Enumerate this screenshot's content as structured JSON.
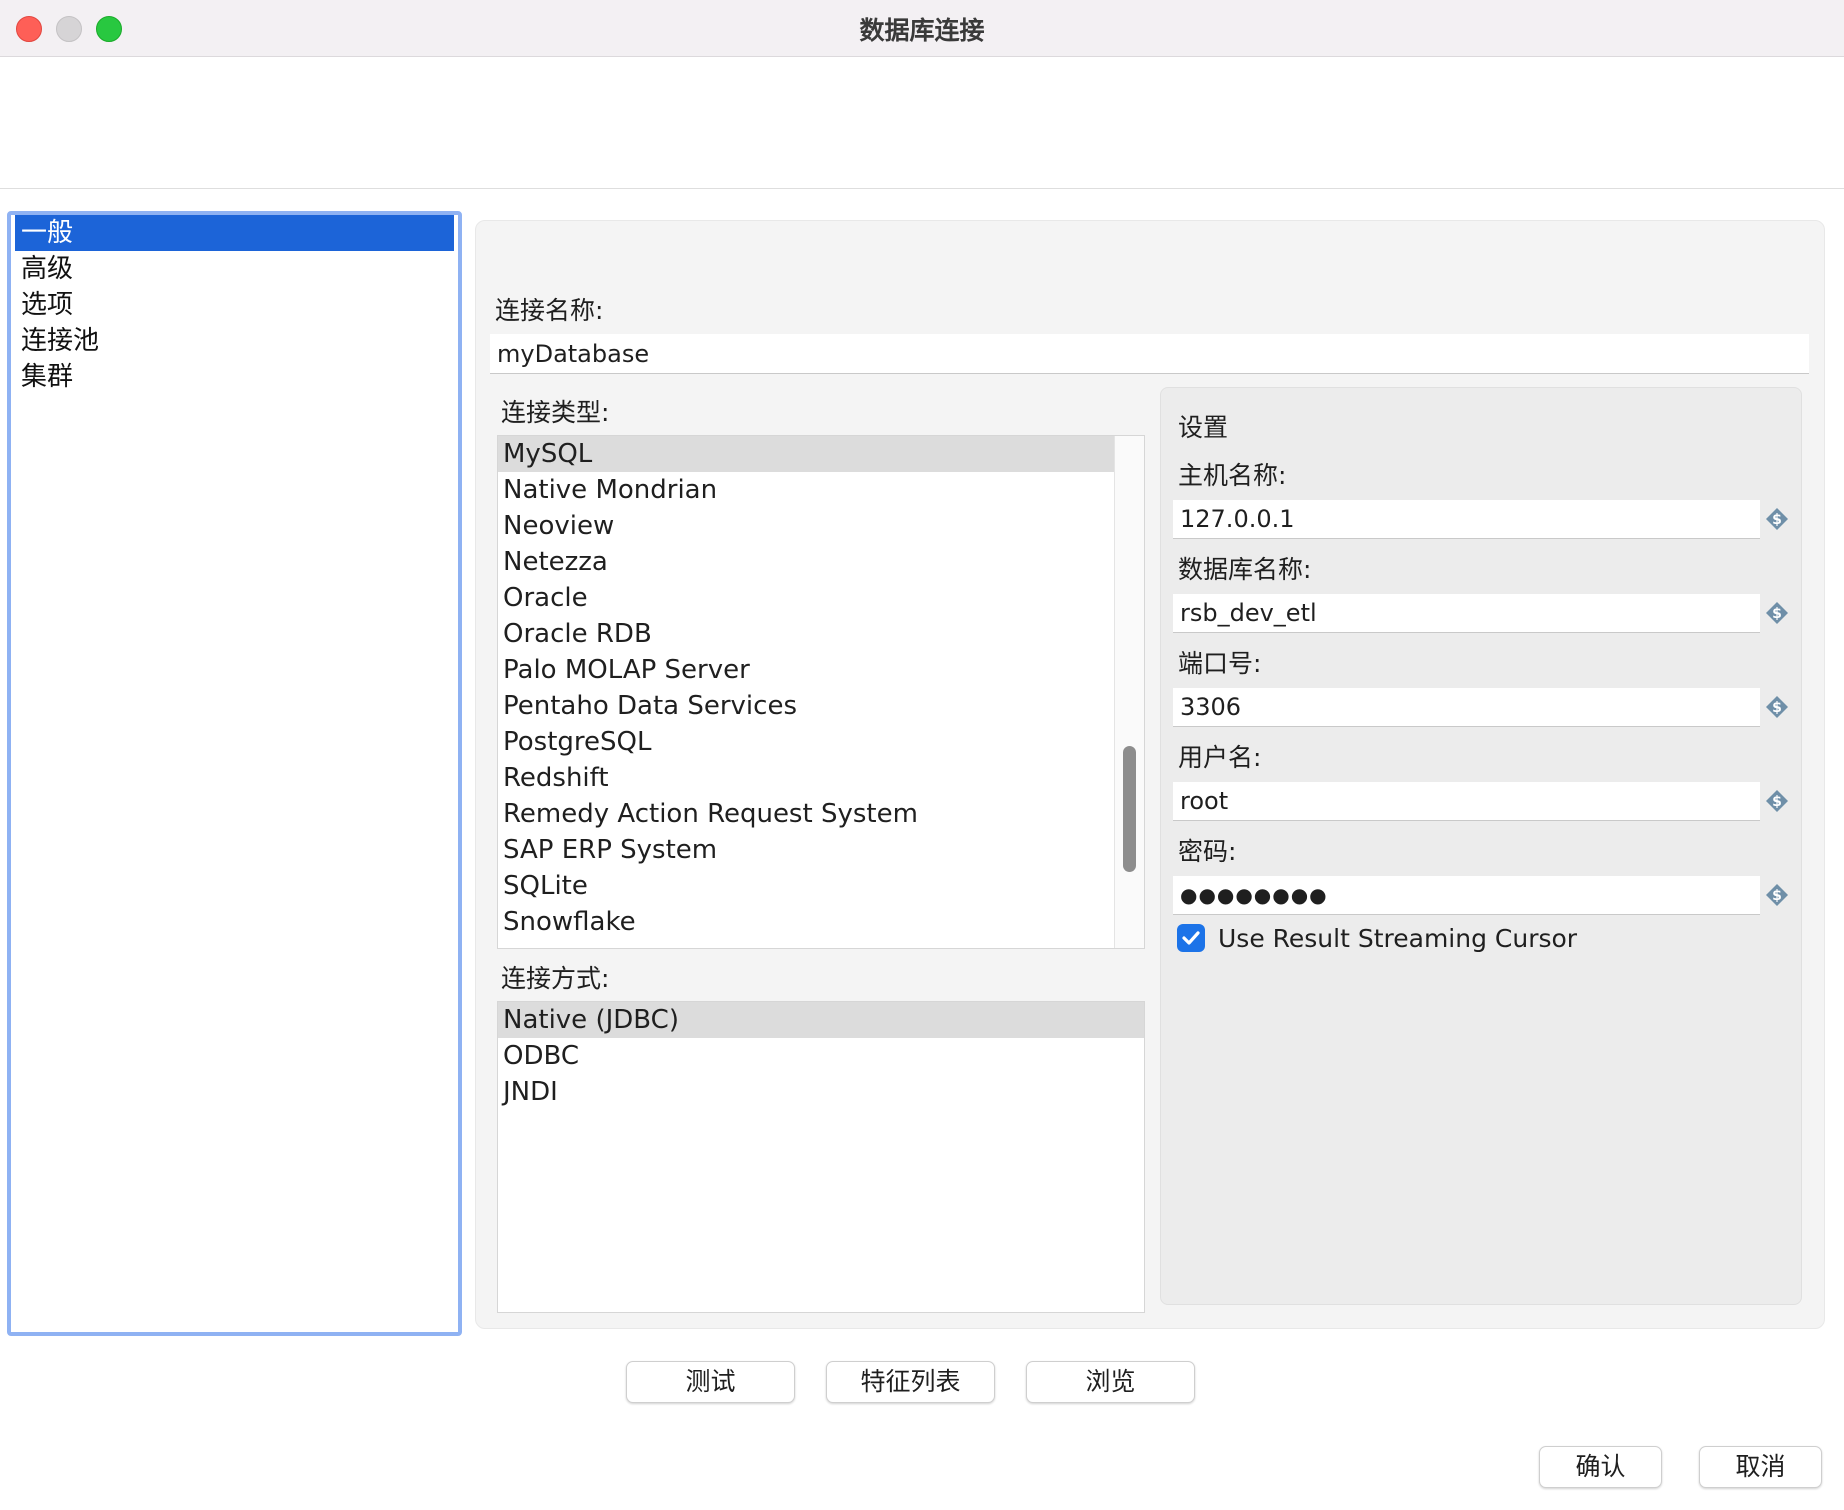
{
  "window": {
    "title": "数据库连接"
  },
  "nav": {
    "items": [
      {
        "label": "一般",
        "selected": true
      },
      {
        "label": "高级"
      },
      {
        "label": "选项"
      },
      {
        "label": "连接池"
      },
      {
        "label": "集群"
      }
    ]
  },
  "connection_name": {
    "label": "连接名称:",
    "value": "myDatabase"
  },
  "connection_type": {
    "label": "连接类型:",
    "items": [
      "MySQL",
      "Native Mondrian",
      "Neoview",
      "Netezza",
      "Oracle",
      "Oracle RDB",
      "Palo MOLAP Server",
      "Pentaho Data Services",
      "PostgreSQL",
      "Redshift",
      "Remedy Action Request System",
      "SAP ERP System",
      "SQLite",
      "Snowflake"
    ],
    "selected": "MySQL"
  },
  "access_method": {
    "label": "连接方式:",
    "items": [
      "Native (JDBC)",
      "ODBC",
      "JNDI"
    ],
    "selected": "Native (JDBC)"
  },
  "settings": {
    "title": "设置",
    "host": {
      "label": "主机名称:",
      "value": "127.0.0.1"
    },
    "database": {
      "label": "数据库名称:",
      "value": "rsb_dev_etl"
    },
    "port": {
      "label": "端口号:",
      "value": "3306"
    },
    "username": {
      "label": "用户名:",
      "value": "root"
    },
    "password": {
      "label": "密码:",
      "value": "●●●●●●●●"
    },
    "streaming": {
      "label": "Use Result Streaming Cursor",
      "checked": true
    }
  },
  "buttons": {
    "test": "测试",
    "features": "特征列表",
    "explore": "浏览",
    "ok": "确认",
    "cancel": "取消"
  },
  "colors": {
    "accent": "#1c64d8",
    "focus_ring": "#8fb2f3",
    "checkbox": "#1c73e8"
  },
  "icons": {
    "variable": "dollar-variable-icon"
  }
}
